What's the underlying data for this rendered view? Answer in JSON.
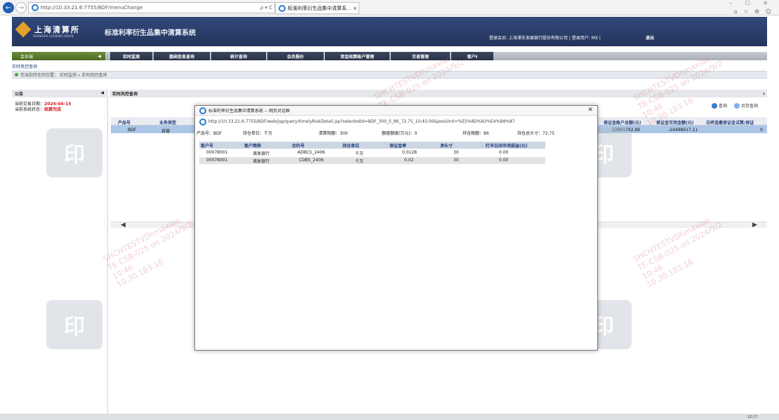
{
  "browser": {
    "url": "http://10.33.21.6:7755/BDF/menuChange",
    "search_ctrl": "ρ ▾ C",
    "tab_title": "标准利率衍生品集中清算系... ×",
    "window_controls": "– ☐ ✕",
    "fav_icons": "⌂ ☆ ⚙ ☺"
  },
  "app": {
    "logo_name": "上海清算所",
    "logo_sub": "SHANGHAI CLEARING HOUSE",
    "system_title": "标准利率衍生品集中清算系统",
    "login_info": "登录会员: 上海浦东发展银行股份有限公司  |  登录用户: MX  |",
    "logout": "退出"
  },
  "nav": {
    "member_tab": "会员端",
    "collapse": "◀",
    "items": [
      "实时监测",
      "基础信息查询",
      "统计查询",
      "会员报价",
      "资金结算账户管理",
      "交易管理",
      "客户t"
    ]
  },
  "breadcrumb": {
    "title": "实时风控查询",
    "path": "您当前所在的位置：  实时监测  »  实时风控查询"
  },
  "left": {
    "header": "公告",
    "arrow": "◀",
    "trade_date_label": "当前交易日期：",
    "trade_date": "2024-04-15",
    "status_label": "当前系统状态：",
    "status": "结算完成"
  },
  "main": {
    "header": "实时风控查询",
    "arrow": "›",
    "query_btn": "查询",
    "saveas_btn": "另存查询",
    "columns": [
      "产品号",
      "业务类型",
      "保证金账户总额(元)",
      "保证金可用金额(元)",
      "日终追缴保证金试算/保证"
    ],
    "row": [
      "BDF",
      "自营",
      "22901382.89",
      "-24498617.11",
      "0"
    ],
    "scroll_left": "◀",
    "scroll_right": "▶"
  },
  "dialog": {
    "title": "标准利率衍生品集中清算系统 -- 网页对话框",
    "close": "✕",
    "url": "http://10.33.21.6:7755/BDF/web/jsp/query/timelyRiskDetail.jsp?selectedId=BDF_300_0_86_72.75_10:45:00&posiUnit=%E5%8D%83%E4%B8%87",
    "summary": [
      "产品号：BDF",
      "持仓单位：千万",
      "清算限额：300",
      "额度额度(万元)：0",
      "持仓限额：86",
      "持仓总头寸：72.75"
    ],
    "columns": [
      "客户号",
      "客户简称",
      "合约号",
      "持仓单位",
      "保证金率",
      "净头寸",
      "盯市日间市场损益(元)"
    ],
    "rows": [
      [
        "00078001",
        "浦发银行",
        "ADBC5_2406",
        "千万",
        "0.0128",
        "30",
        "0.00"
      ],
      [
        "00078001",
        "浦发银行",
        "CDB5_2406",
        "千万",
        "0.02",
        "30",
        "0.00"
      ]
    ]
  },
  "watermark": {
    "line1": "SHCHTESTVDI\\maxiao",
    "line2": "TE-CSB-025 on 2024/9/2",
    "line3": "10:46",
    "line4": "10.30.183.16",
    "seal": "印"
  },
  "status_right": "12:17"
}
